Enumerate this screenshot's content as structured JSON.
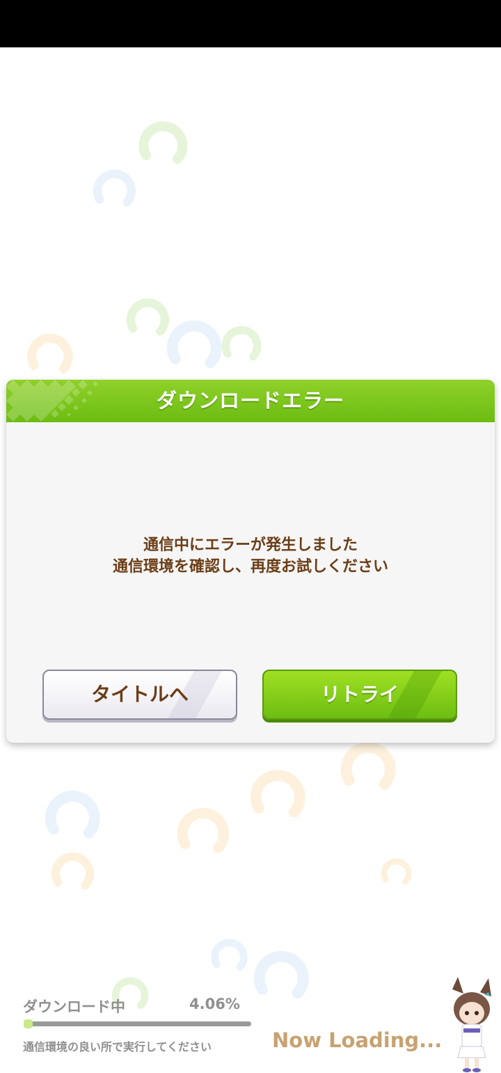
{
  "dialog": {
    "title": "ダウンロードエラー",
    "message_line1": "通信中にエラーが発生しました",
    "message_line2": "通信環境を確認し、再度お試しください",
    "button_title": "タイトルへ",
    "button_retry": "リトライ"
  },
  "download": {
    "label": "ダウンロード中",
    "percent_text": "4.06%",
    "progress": 0.0406,
    "hint": "通信環境の良い所で実行してください",
    "loading_text": "Now Loading..."
  },
  "colors": {
    "accent_green": "#7ac51a",
    "text_brown": "#6b3d16",
    "loading_tan": "#c7a271"
  }
}
